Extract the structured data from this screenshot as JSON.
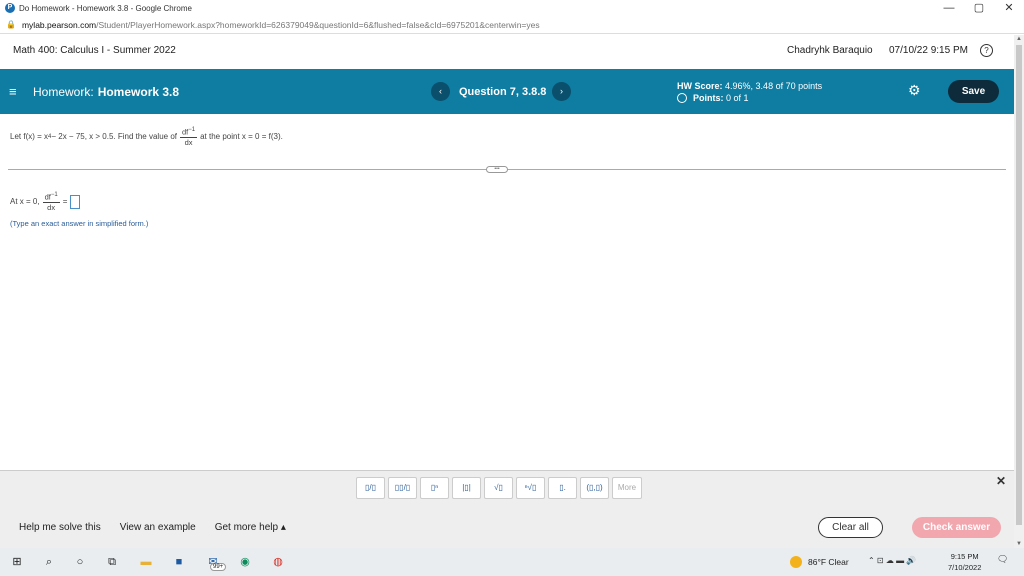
{
  "browser": {
    "window_title": "Do Homework - Homework 3.8 - Google Chrome",
    "url_domain": "mylab.pearson.com",
    "url_path": "/Student/PlayerHomework.aspx?homeworkId=626379049&questionId=6&flushed=false&cId=6975201&centerwin=yes",
    "minimize": "—",
    "maximize": "▢",
    "close": "✕"
  },
  "header": {
    "course": "Math 400: Calculus I - Summer 2022",
    "user": "Chadryhk Baraquio",
    "datetime": "07/10/22 9:15 PM",
    "help": "?"
  },
  "hw_bar": {
    "menu_icon": "≡",
    "label": "Homework:",
    "name": "Homework 3.8",
    "prev": "‹",
    "question": "Question 7, 3.8.8",
    "next": "›",
    "score_label": "HW Score:",
    "score_value": "4.96%, 3.48 of 70 points",
    "points_label": "Points:",
    "points_value": "0 of 1",
    "save": "Save"
  },
  "question": {
    "prefix": "Let f(x) = x",
    "exp4": "4",
    "middle": " − 2x − 75, x > 0.5. Find the value of",
    "frac_num": "df",
    "frac_num_sup": "−1",
    "frac_den": "dx",
    "suffix": "at the point x = 0 = f(3)."
  },
  "answer": {
    "prefix": "At x = 0,",
    "frac_num": "df",
    "frac_num_sup": "−1",
    "frac_den": "dx",
    "equals": "=",
    "hint": "(Type an exact answer in simplified form.)"
  },
  "toolbar": {
    "tools": [
      "▯/▯",
      "▯▯/▯",
      "▯ⁿ",
      "|▯|",
      "√▯",
      "ⁿ√▯",
      "▯.",
      "(▯,▯)"
    ],
    "more": "More",
    "close": "✕",
    "help_me": "Help me solve this",
    "example": "View an example",
    "more_help": "Get more help ▴",
    "clear_all": "Clear all",
    "check_answer": "Check answer"
  },
  "taskbar": {
    "weather": "86°F Clear",
    "time": "9:15 PM",
    "date": "7/10/2022",
    "badge": "99+"
  },
  "colors": {
    "hw_bar": "#0f7ca1",
    "save_button": "#0d2b3a",
    "check_button": "#f2a6ae"
  }
}
